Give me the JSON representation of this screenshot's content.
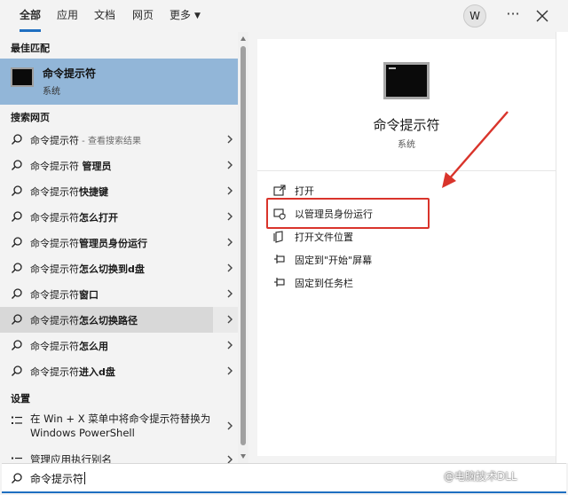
{
  "tabs": [
    {
      "label": "全部",
      "active": true
    },
    {
      "label": "应用",
      "active": false
    },
    {
      "label": "文档",
      "active": false
    },
    {
      "label": "网页",
      "active": false
    },
    {
      "label": "更多",
      "active": false
    }
  ],
  "user": {
    "avatar_letter": "W"
  },
  "toolbar": {
    "more_glyph": "···"
  },
  "left": {
    "best_match_title": "最佳匹配",
    "best_match": {
      "name": "命令提示符",
      "type": "系统"
    },
    "web_title": "搜索网页",
    "web_results": [
      {
        "prefix": "命令提示符",
        "bold": "",
        "hint": " - 查看搜索结果"
      },
      {
        "prefix": "命令提示符 ",
        "bold": "管理员",
        "hint": ""
      },
      {
        "prefix": "命令提示符",
        "bold": "快捷键",
        "hint": ""
      },
      {
        "prefix": "命令提示符",
        "bold": "怎么打开",
        "hint": ""
      },
      {
        "prefix": "命令提示符",
        "bold": "管理员身份运行",
        "hint": ""
      },
      {
        "prefix": "命令提示符",
        "bold": "怎么切换到d盘",
        "hint": ""
      },
      {
        "prefix": "命令提示符",
        "bold": "窗口",
        "hint": ""
      },
      {
        "prefix": "命令提示符",
        "bold": "怎么切换路径",
        "hint": ""
      },
      {
        "prefix": "命令提示符",
        "bold": "怎么用",
        "hint": ""
      },
      {
        "prefix": "命令提示符",
        "bold": "进入d盘",
        "hint": ""
      }
    ],
    "settings_title": "设置",
    "settings": [
      {
        "label": "在 Win + X 菜单中将命令提示符替换为 Windows PowerShell"
      },
      {
        "label": "管理应用执行别名"
      }
    ]
  },
  "preview": {
    "title": "命令提示符",
    "subtitle": "系统",
    "actions": [
      {
        "label": "打开"
      },
      {
        "label": "以管理员身份运行"
      },
      {
        "label": "打开文件位置"
      },
      {
        "label": "固定到\"开始\"屏幕"
      },
      {
        "label": "固定到任务栏"
      }
    ]
  },
  "search": {
    "query": "命令提示符"
  },
  "watermark": "@电脑技术DLL",
  "colors": {
    "accent": "#1f6fc1",
    "highlight": "#d9342b",
    "selected": "#92b6d8"
  }
}
